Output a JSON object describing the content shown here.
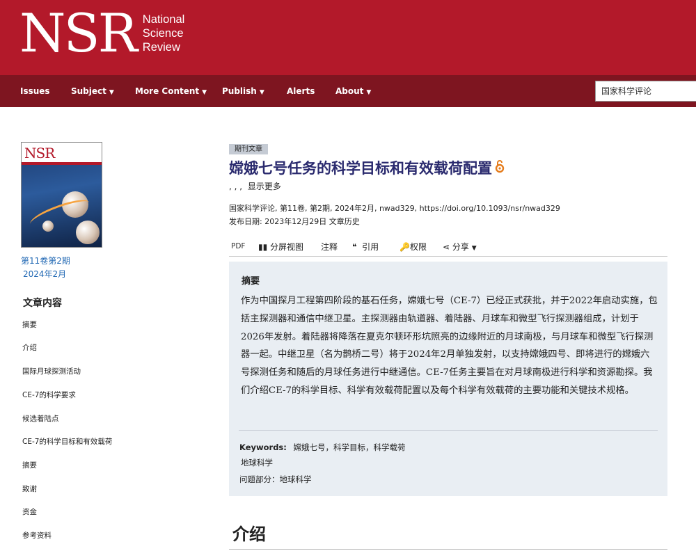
{
  "header": {
    "logo_letters": "NSR",
    "logo_line1": "National",
    "logo_line2": "Science",
    "logo_line3": "Review",
    "brand_color": "#b3192a",
    "nav_color": "#7e1520"
  },
  "nav": {
    "issues": "Issues",
    "subject": "Subject",
    "more_content": "More Content",
    "publish": "Publish",
    "alerts": "Alerts",
    "about": "About",
    "caret": "▼"
  },
  "search": {
    "value": "国家科学评论"
  },
  "sidebar": {
    "cover_label": "NSR",
    "issue_link": "第11卷第2期",
    "issue_date": "2024年2月",
    "toc_title": "文章内容",
    "toc_items": [
      "摘要",
      "介绍",
      "国际月球探测活动",
      "CE-7的科学要求",
      "候选着陆点",
      "CE-7的科学目标和有效载荷",
      "摘要",
      "致谢",
      "资金",
      "参考资料"
    ]
  },
  "article": {
    "badge": "期刊文章",
    "title": "嫦娥七号任务的科学目标和有效载荷配置",
    "authors": ", , ,",
    "show_more": "显示更多",
    "citation": "国家科学评论, 第11卷, 第2期, 2024年2月, nwad329, https://doi.org/10.1093/nsr/nwad329",
    "pub_label": "发布日期:",
    "pub_date": "2023年12月29日",
    "history": "文章历史"
  },
  "toolbar": {
    "pdf": "PDF",
    "split": "分屏视图",
    "notes": "注释",
    "cite": "引用",
    "rights": "权限",
    "share": "分享"
  },
  "abstract": {
    "heading": "摘要",
    "body": "作为中国探月工程第四阶段的基石任务，嫦娥七号（CE-7）已经正式获批，并于2022年启动实施，包括主探测器和通信中继卫星。主探测器由轨道器、着陆器、月球车和微型飞行探测器组成，计划于2026年发射。着陆器将降落在夏克尔顿环形坑照亮的边缘附近的月球南极，与月球车和微型飞行探测器一起。中继卫星（名为鹊桥二号）将于2024年2月单独发射，以支持嫦娥四号、即将进行的嫦娥六号探测任务和随后的月球任务进行中继通信。CE-7任务主要旨在对月球南极进行科学和资源勘探。我们介绍CE-7的科学目标、科学有效载荷配置以及每个科学有效载荷的主要功能和关键技术规格。",
    "keywords_label": "Keywords:",
    "keywords": "嫦娥七号，科学目标，科学载荷",
    "subject": "地球科学",
    "section": "问题部分：地球科学"
  },
  "intro": {
    "heading": "介绍"
  }
}
